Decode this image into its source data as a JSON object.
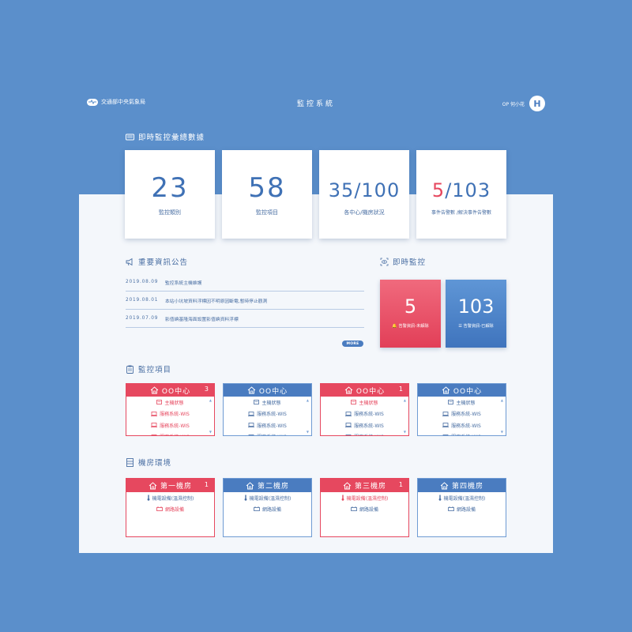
{
  "header": {
    "org_name": "交通部中央氣象局",
    "app_title": "監控系統",
    "user_name": "OP 何小花",
    "avatar_letter": "H"
  },
  "overview": {
    "title": "即時監控彙總數據",
    "stats": [
      {
        "value": "23",
        "label": "監控類別"
      },
      {
        "value": "58",
        "label": "監控項目"
      },
      {
        "value_a": "35",
        "value_b": "100",
        "label": "各中心/機房狀況"
      },
      {
        "value_a": "5",
        "value_b": "103",
        "label": "事件告警數 /解決事件告警數"
      }
    ]
  },
  "announcements": {
    "title": "重要資訊公告",
    "items": [
      {
        "date": "2019.08.09",
        "text": "監控系統主機維護"
      },
      {
        "date": "2019.08.01",
        "text": "本站小坑坡資料浮標因不明原因斷電,暫時停止觀測"
      },
      {
        "date": "2019.07.09",
        "text": "影值嶼基隆海面設置影值嶼資料浮標"
      }
    ],
    "more_label": "MORE"
  },
  "realtime": {
    "title": "即時監控",
    "unresolved": {
      "value": "5",
      "label": "告警資訊-未解除"
    },
    "resolved": {
      "value": "103",
      "label": "告警資訊-已解除"
    }
  },
  "monitor": {
    "title": "監控項目",
    "cards": [
      {
        "name": "OO中心",
        "count": "3",
        "status": "red",
        "items": [
          {
            "text": "主機狀態",
            "status": "red"
          },
          {
            "text": "服務系統-WIS",
            "status": "red"
          },
          {
            "text": "服務系統-WIS",
            "status": "red"
          },
          {
            "text": "服務系統-WIS",
            "status": "red"
          }
        ]
      },
      {
        "name": "OO中心",
        "count": "",
        "status": "blue",
        "items": [
          {
            "text": "主機狀態",
            "status": "blue"
          },
          {
            "text": "服務系統-WIS",
            "status": "blue"
          },
          {
            "text": "服務系統-WIS",
            "status": "blue"
          },
          {
            "text": "服務系統-WIS",
            "status": "blue"
          }
        ]
      },
      {
        "name": "OO中心",
        "count": "1",
        "status": "red",
        "items": [
          {
            "text": "主機狀態",
            "status": "red"
          },
          {
            "text": "服務系統-WIS",
            "status": "blue"
          },
          {
            "text": "服務系統-WIS",
            "status": "blue"
          },
          {
            "text": "服務系統-WIS",
            "status": "blue"
          }
        ]
      },
      {
        "name": "OO中心",
        "count": "",
        "status": "blue",
        "items": [
          {
            "text": "主機狀態",
            "status": "blue"
          },
          {
            "text": "服務系統-WIS",
            "status": "blue"
          },
          {
            "text": "服務系統-WIS",
            "status": "blue"
          },
          {
            "text": "服務系統-WIS",
            "status": "blue"
          }
        ]
      }
    ]
  },
  "rooms": {
    "title": "機房環境",
    "cards": [
      {
        "name": "第一機房",
        "count": "1",
        "status": "red",
        "items": [
          {
            "text": "機電設備(溫濕控制)",
            "status": "blue"
          },
          {
            "text": "網路設備",
            "status": "red"
          }
        ]
      },
      {
        "name": "第二機房",
        "count": "",
        "status": "blue",
        "items": [
          {
            "text": "機電設備(溫濕控制)",
            "status": "blue"
          },
          {
            "text": "網路設備",
            "status": "blue"
          }
        ]
      },
      {
        "name": "第三機房",
        "count": "1",
        "status": "red",
        "items": [
          {
            "text": "機電設備(溫濕控制)",
            "status": "red"
          },
          {
            "text": "網路設備",
            "status": "blue"
          }
        ]
      },
      {
        "name": "第四機房",
        "count": "",
        "status": "blue",
        "items": [
          {
            "text": "機電設備(溫濕控制)",
            "status": "blue"
          },
          {
            "text": "網路設備",
            "status": "blue"
          }
        ]
      }
    ]
  },
  "colors": {
    "background": "#5b8fcb",
    "alert_red": "#e6485f",
    "primary_blue": "#4a7cc0",
    "panel": "#f4f7fb"
  }
}
